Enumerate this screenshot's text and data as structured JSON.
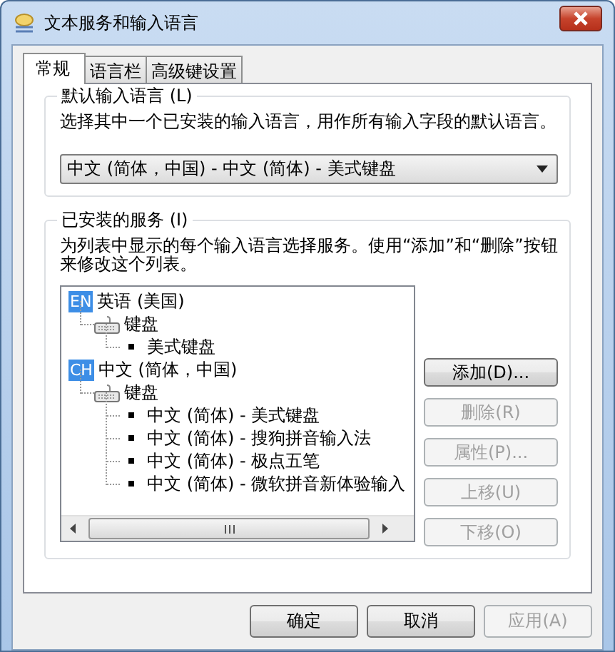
{
  "window": {
    "title": "文本服务和输入语言"
  },
  "tabs": [
    {
      "label": "常规",
      "selected": true
    },
    {
      "label": "语言栏",
      "selected": false
    },
    {
      "label": "高级键设置",
      "selected": false
    }
  ],
  "default_language": {
    "legend": "默认输入语言 (L)",
    "description": "选择其中一个已安装的输入语言，用作所有输入字段的默认语言。",
    "dropdown": {
      "value": "中文 (简体，中国) - 中文 (简体) - 美式键盘"
    }
  },
  "installed_services": {
    "legend": "已安装的服务 (I)",
    "description": "为列表中显示的每个输入语言选择服务。使用“添加”和“删除”按钮来修改这个列表。",
    "tree": [
      {
        "kind": "language",
        "badge": "EN",
        "label": "英语 (美国)",
        "children": [
          {
            "kind": "category",
            "label": "键盘",
            "children": [
              {
                "kind": "layout",
                "label": "美式键盘"
              }
            ]
          }
        ]
      },
      {
        "kind": "language",
        "badge": "CH",
        "label": "中文 (简体，中国)",
        "children": [
          {
            "kind": "category",
            "label": "键盘",
            "children": [
              {
                "kind": "layout",
                "label": "中文 (简体) - 美式键盘"
              },
              {
                "kind": "layout",
                "label": "中文 (简体) - 搜狗拼音输入法"
              },
              {
                "kind": "layout",
                "label": "中文 (简体) - 极点五笔"
              },
              {
                "kind": "layout",
                "label": "中文 (简体) - 微软拼音新体验输入"
              }
            ]
          }
        ]
      }
    ],
    "buttons": [
      {
        "label": "添加(D)...",
        "disabled": false
      },
      {
        "label": "删除(R)",
        "disabled": true
      },
      {
        "label": "属性(P)...",
        "disabled": true
      },
      {
        "label": "上移(U)",
        "disabled": true
      },
      {
        "label": "下移(O)",
        "disabled": true
      }
    ]
  },
  "footer_buttons": [
    {
      "label": "确定",
      "disabled": false
    },
    {
      "label": "取消",
      "disabled": false
    },
    {
      "label": "应用(A)",
      "disabled": true
    }
  ]
}
